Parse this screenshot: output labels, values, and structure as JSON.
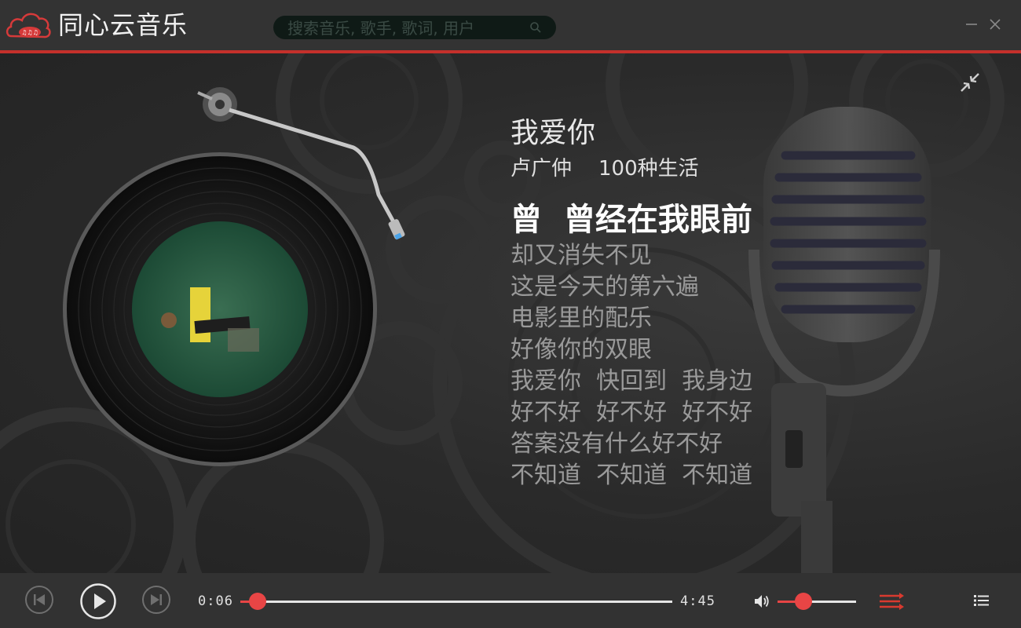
{
  "app": {
    "title": "同心云音乐",
    "logo_icon": "cloud-logo-icon"
  },
  "search": {
    "placeholder": "搜索音乐, 歌手, 歌词, 用户",
    "value": "",
    "icon": "search-icon"
  },
  "window_controls": {
    "minimize_icon": "minimize-icon",
    "close_icon": "close-icon"
  },
  "song": {
    "title": "我爱你",
    "artist": "卢广仲",
    "album": "100种生活"
  },
  "lyrics": {
    "current": "曾  曾经在我眼前",
    "upcoming": [
      "却又消失不见",
      "这是今天的第六遍",
      "电影里的配乐",
      "好像你的双眼",
      "我爱你  快回到  我身边",
      "好不好  好不好  好不好",
      "答案没有什么好不好",
      "不知道  不知道  不知道"
    ]
  },
  "player": {
    "elapsed": "0:06",
    "duration": "4:45",
    "progress_fraction": 0.04,
    "volume_fraction": 0.33
  },
  "colors": {
    "accent": "#e84545",
    "title_bar": "#333333",
    "title_line": "#c4302b",
    "control_bar": "#323232"
  }
}
